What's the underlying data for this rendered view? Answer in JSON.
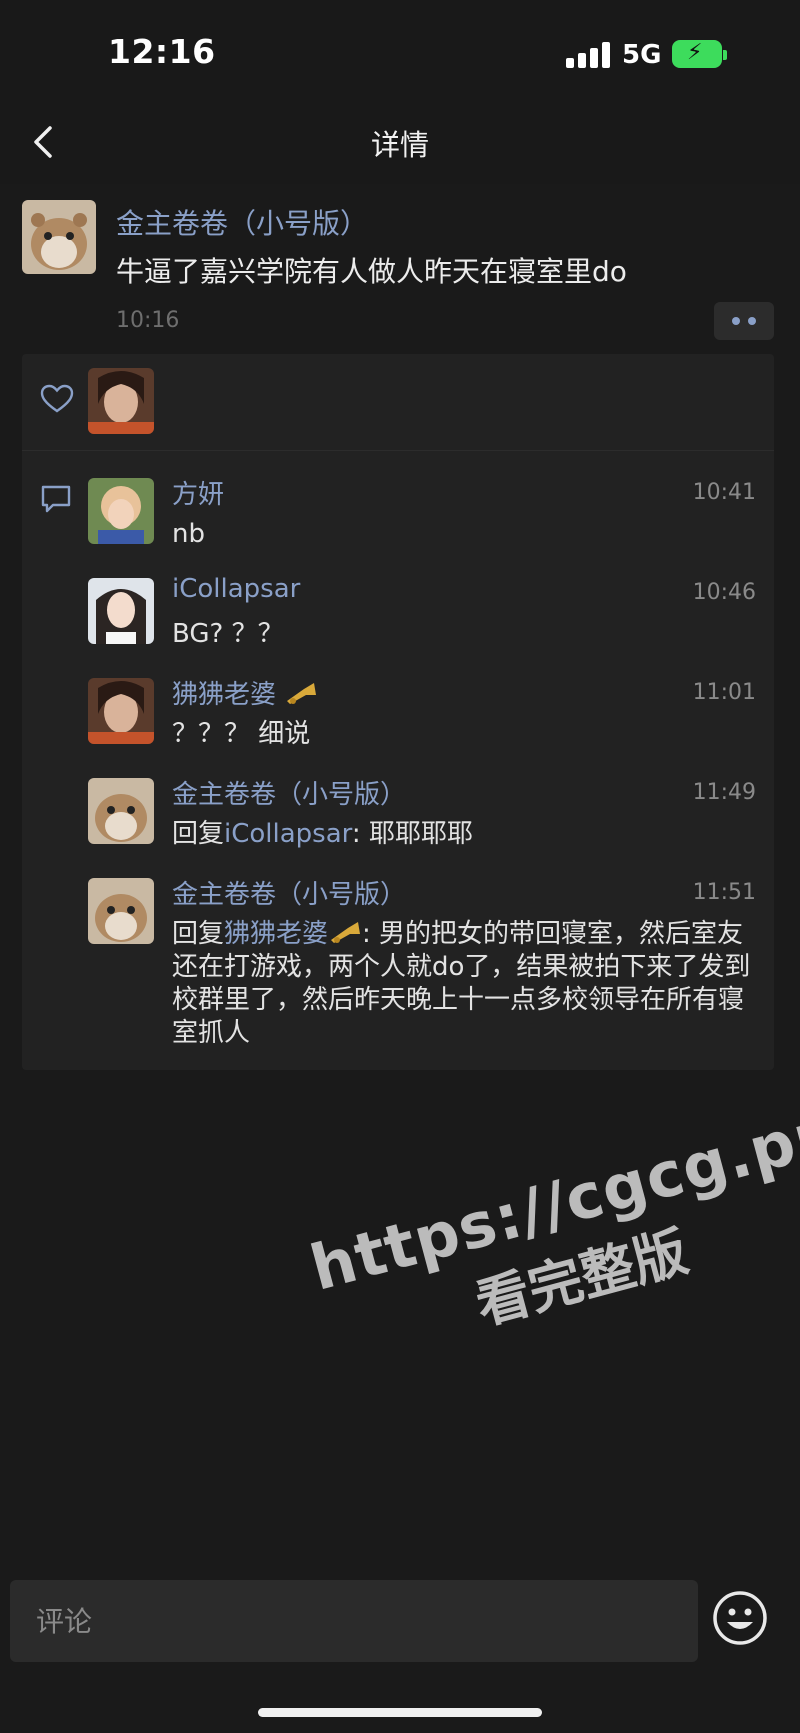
{
  "status_bar": {
    "time": "12:16",
    "network": "5G"
  },
  "nav": {
    "title": "详情"
  },
  "post": {
    "author": "金主卷卷（小号版）",
    "text": "牛逼了嘉兴学院有人做人昨天在寝室里do",
    "time": "10:16"
  },
  "comments": [
    {
      "name": "方妍",
      "time": "10:41",
      "text": "nb"
    },
    {
      "name": "iCollapsar",
      "time": "10:46",
      "text": "BG? ？？"
    },
    {
      "name": "狒狒老婆",
      "time": "11:01",
      "text": "？？？ 细说"
    },
    {
      "name": "金主卷卷（小号版）",
      "time": "11:49",
      "reply_prefix": "回复",
      "reply_to": "iCollapsar",
      "text": ": 耶耶耶耶"
    },
    {
      "name": "金主卷卷（小号版）",
      "time": "11:51",
      "reply_prefix": "回复",
      "reply_to": "狒狒老婆",
      "text": ": 男的把女的带回寝室，然后室友还在打游戏，两个人就do了，结果被拍下来了发到校群里了，然后昨天晚上十一点多校领导在所有寝室抓人"
    }
  ],
  "watermark": {
    "url": "https://cgcg.pro",
    "text": "看完整版"
  },
  "input": {
    "placeholder": "评论"
  }
}
